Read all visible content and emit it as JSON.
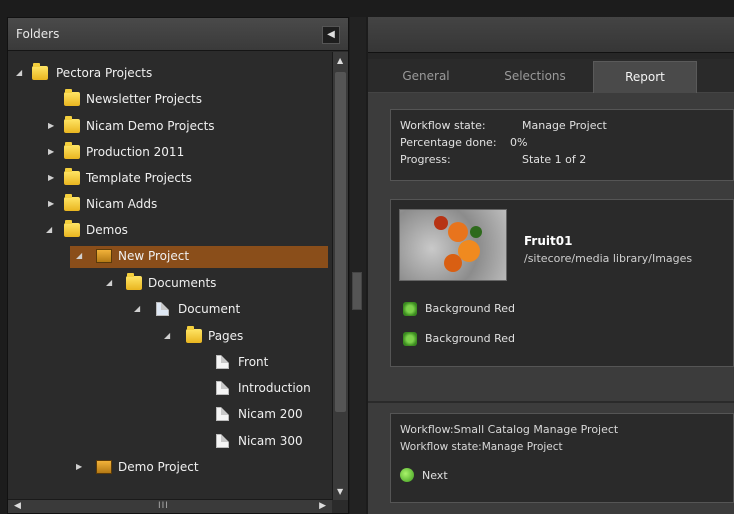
{
  "folders_panel": {
    "title": "Folders",
    "collapse_icon": "chevron-left-icon",
    "tree": [
      {
        "label": "Pectora Projects",
        "icon": "folder-icon",
        "arrow": "◢"
      },
      {
        "label": "Newsletter Projects",
        "icon": "folder-icon",
        "arrow": ""
      },
      {
        "label": "Nicam Demo Projects",
        "icon": "folder-icon",
        "arrow": "▶"
      },
      {
        "label": "Production 2011",
        "icon": "folder-icon",
        "arrow": "▶"
      },
      {
        "label": "Template Projects",
        "icon": "folder-icon",
        "arrow": "▶"
      },
      {
        "label": "Nicam Adds",
        "icon": "folder-icon",
        "arrow": "▶"
      },
      {
        "label": "Demos",
        "icon": "folder-icon",
        "arrow": "◢"
      },
      {
        "label": "New Project",
        "icon": "project-icon",
        "arrow": "◢",
        "selected": true
      },
      {
        "label": "Documents",
        "icon": "folder-icon",
        "arrow": "◢"
      },
      {
        "label": "Document",
        "icon": "document-icon",
        "arrow": "◢"
      },
      {
        "label": "Pages",
        "icon": "folder-icon",
        "arrow": "◢"
      },
      {
        "label": "Front",
        "icon": "page-icon",
        "arrow": ""
      },
      {
        "label": "Introduction",
        "icon": "page-icon",
        "arrow": ""
      },
      {
        "label": "Nicam 200",
        "icon": "page-icon",
        "arrow": ""
      },
      {
        "label": "Nicam 300",
        "icon": "page-icon",
        "arrow": ""
      },
      {
        "label": "Demo Project",
        "icon": "project-icon",
        "arrow": "▶"
      }
    ],
    "hscroll_grip": "III"
  },
  "tabs": [
    {
      "label": "General"
    },
    {
      "label": "Selections"
    },
    {
      "label": "Report",
      "active": true
    }
  ],
  "report": {
    "workflow_state_label": "Workflow state:",
    "workflow_state_value": "Manage Project",
    "percentage_label": "Percentage done:",
    "percentage_value": "0%",
    "progress_label": "Progress:",
    "progress_value": "State 1 of 2"
  },
  "media": {
    "name": "Fruit01",
    "path": "/sitecore/media library/Images",
    "actions": [
      {
        "label": "Background Red",
        "icon": "recycle-icon"
      },
      {
        "label": "Background Red",
        "icon": "recycle-icon"
      }
    ]
  },
  "workflow": {
    "line1": "Workflow:Small Catalog Manage Project",
    "line2": "Workflow state:Manage Project",
    "next_label": "Next",
    "next_icon": "next-arrow-icon"
  },
  "colors": {
    "selected_row": "#8a4e1a",
    "panel_bg": "#2b2b2b",
    "accent_folder": "#e9b520"
  }
}
